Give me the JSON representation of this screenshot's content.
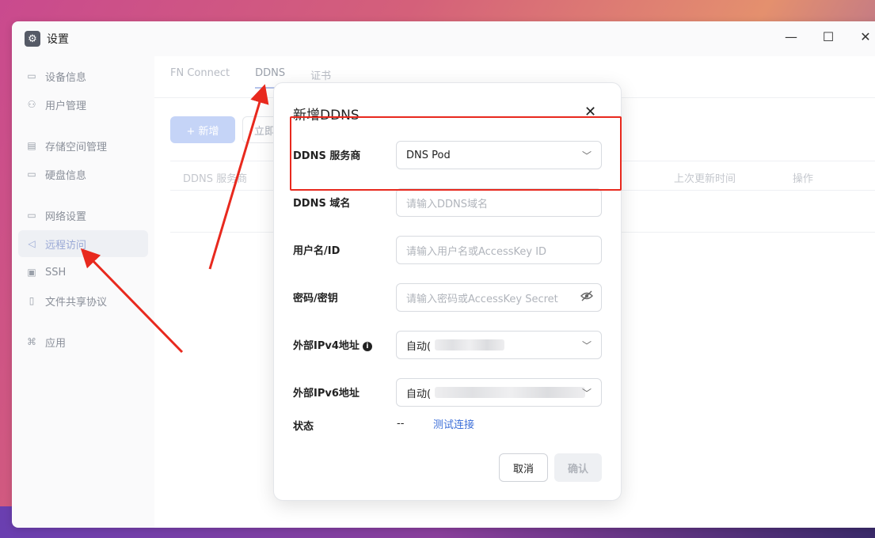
{
  "window": {
    "title": "设置",
    "controls": {
      "minimize": "—",
      "maximize": "☐",
      "close": "✕"
    }
  },
  "sidebar": {
    "items": [
      {
        "label": "设备信息",
        "icon": "monitor-icon"
      },
      {
        "label": "用户管理",
        "icon": "user-icon"
      },
      {
        "label": "存储空间管理",
        "icon": "storage-icon"
      },
      {
        "label": "硬盘信息",
        "icon": "disk-icon"
      },
      {
        "label": "网络设置",
        "icon": "network-icon"
      },
      {
        "label": "远程访问",
        "icon": "send-icon"
      },
      {
        "label": "SSH",
        "icon": "terminal-icon"
      },
      {
        "label": "文件共享协议",
        "icon": "file-icon"
      },
      {
        "label": "应用",
        "icon": "apps-icon"
      }
    ],
    "active_index": 5
  },
  "main": {
    "tabs": [
      "FN Connect",
      "DDNS",
      "证书"
    ],
    "active_tab": "DDNS",
    "add_button": "+ 新增",
    "now_button": "立即",
    "table_headers": [
      "DDNS 服务商",
      "上次更新时间",
      "操作"
    ]
  },
  "dialog": {
    "title": "新增DDNS",
    "close": "✕",
    "fields": {
      "provider": {
        "label": "DDNS 服务商",
        "value": "DNS Pod"
      },
      "domain": {
        "label": "DDNS 域名",
        "placeholder": "请输入DDNS域名"
      },
      "username": {
        "label": "用户名/ID",
        "placeholder": "请输入用户名或AccessKey ID"
      },
      "password": {
        "label": "密码/密钥",
        "placeholder": "请输入密码或AccessKey Secret"
      },
      "ipv4": {
        "label": "外部IPv4地址",
        "value": "自动("
      },
      "ipv6": {
        "label": "外部IPv6地址",
        "value": "自动("
      },
      "status": {
        "label": "状态",
        "value": "--",
        "link": "测试连接"
      }
    },
    "cancel_button": "取消",
    "confirm_button": "确认"
  },
  "colors": {
    "accent": "#3d6fd8",
    "annotation_red": "#e8291e",
    "active_nav_bg": "#eef0f4"
  }
}
